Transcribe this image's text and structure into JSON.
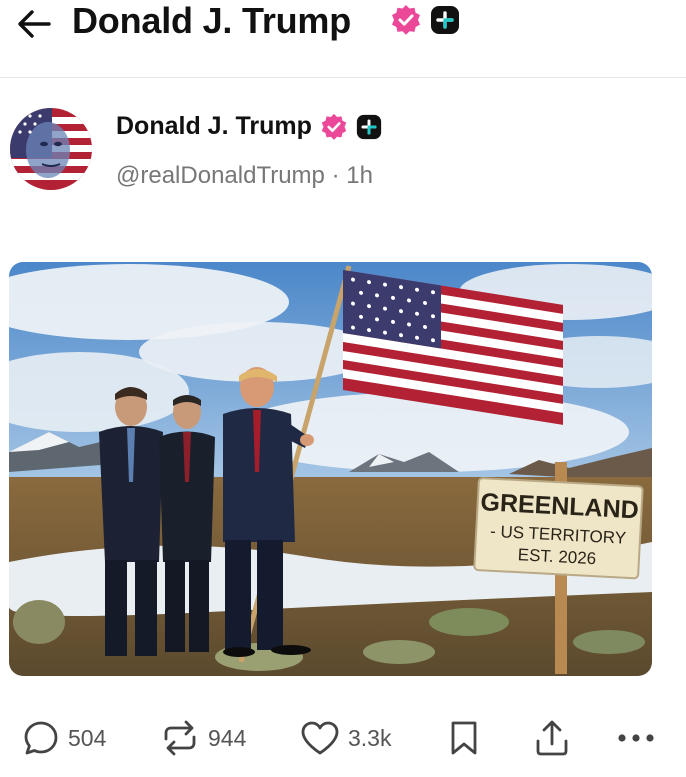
{
  "header": {
    "title": "Donald J. Trump"
  },
  "post": {
    "display_name": "Donald J. Trump",
    "handle": "@realDonaldTrump",
    "separator": "·",
    "time": "1h"
  },
  "media": {
    "sign_line1": "GREENLAND",
    "sign_line2": "- US TERRITORY",
    "sign_line3": "EST. 2026"
  },
  "actions": {
    "replies": "504",
    "retruths": "944",
    "likes": "3.3k"
  },
  "colors": {
    "verified_badge": "#ec4899",
    "text_primary": "#111111",
    "text_secondary": "#777777"
  },
  "icons": [
    "back-arrow-icon",
    "verified-badge-icon",
    "plus-badge-icon",
    "reply-icon",
    "repost-icon",
    "like-icon",
    "bookmark-icon",
    "share-icon",
    "more-icon"
  ]
}
